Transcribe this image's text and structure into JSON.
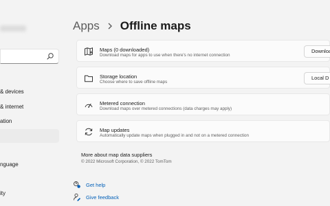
{
  "sidebar": {
    "search": {
      "value": "",
      "placeholder": ""
    },
    "items": [
      {
        "label": "& devices"
      },
      {
        "label": "& internet"
      },
      {
        "label": "ation"
      },
      {
        "label": ""
      },
      {
        "label": ""
      },
      {
        "label": "nguage"
      },
      {
        "label": ""
      },
      {
        "label": "ity"
      }
    ]
  },
  "breadcrumb": {
    "parent": "Apps",
    "current": "Offline maps"
  },
  "cards": [
    {
      "title": "Maps (0 downloaded)",
      "description": "Download maps for apps to use when there's no internet connection",
      "button": "Download",
      "icon": "offline-map-icon"
    },
    {
      "title": "Storage location",
      "description": "Choose where to save offline maps",
      "button": "Local D",
      "icon": "folder-icon"
    },
    {
      "title": "Metered connection",
      "description": "Download maps over metered connections (data charges may apply)",
      "icon": "metered-connection-icon"
    },
    {
      "title": "Map updates",
      "description": "Automatically update maps when plugged in and not on a metered connection",
      "icon": "sync-icon"
    }
  ],
  "suppliers": {
    "title": "More about map data suppliers",
    "copyright": "© 2022 Microsoft Corporation, © 2022 TomTom"
  },
  "links": {
    "get_help": "Get help",
    "give_feedback": "Give feedback"
  },
  "colors": {
    "background": "#f3f3f3",
    "card": "#fbfbfb",
    "link": "#005fb8"
  }
}
